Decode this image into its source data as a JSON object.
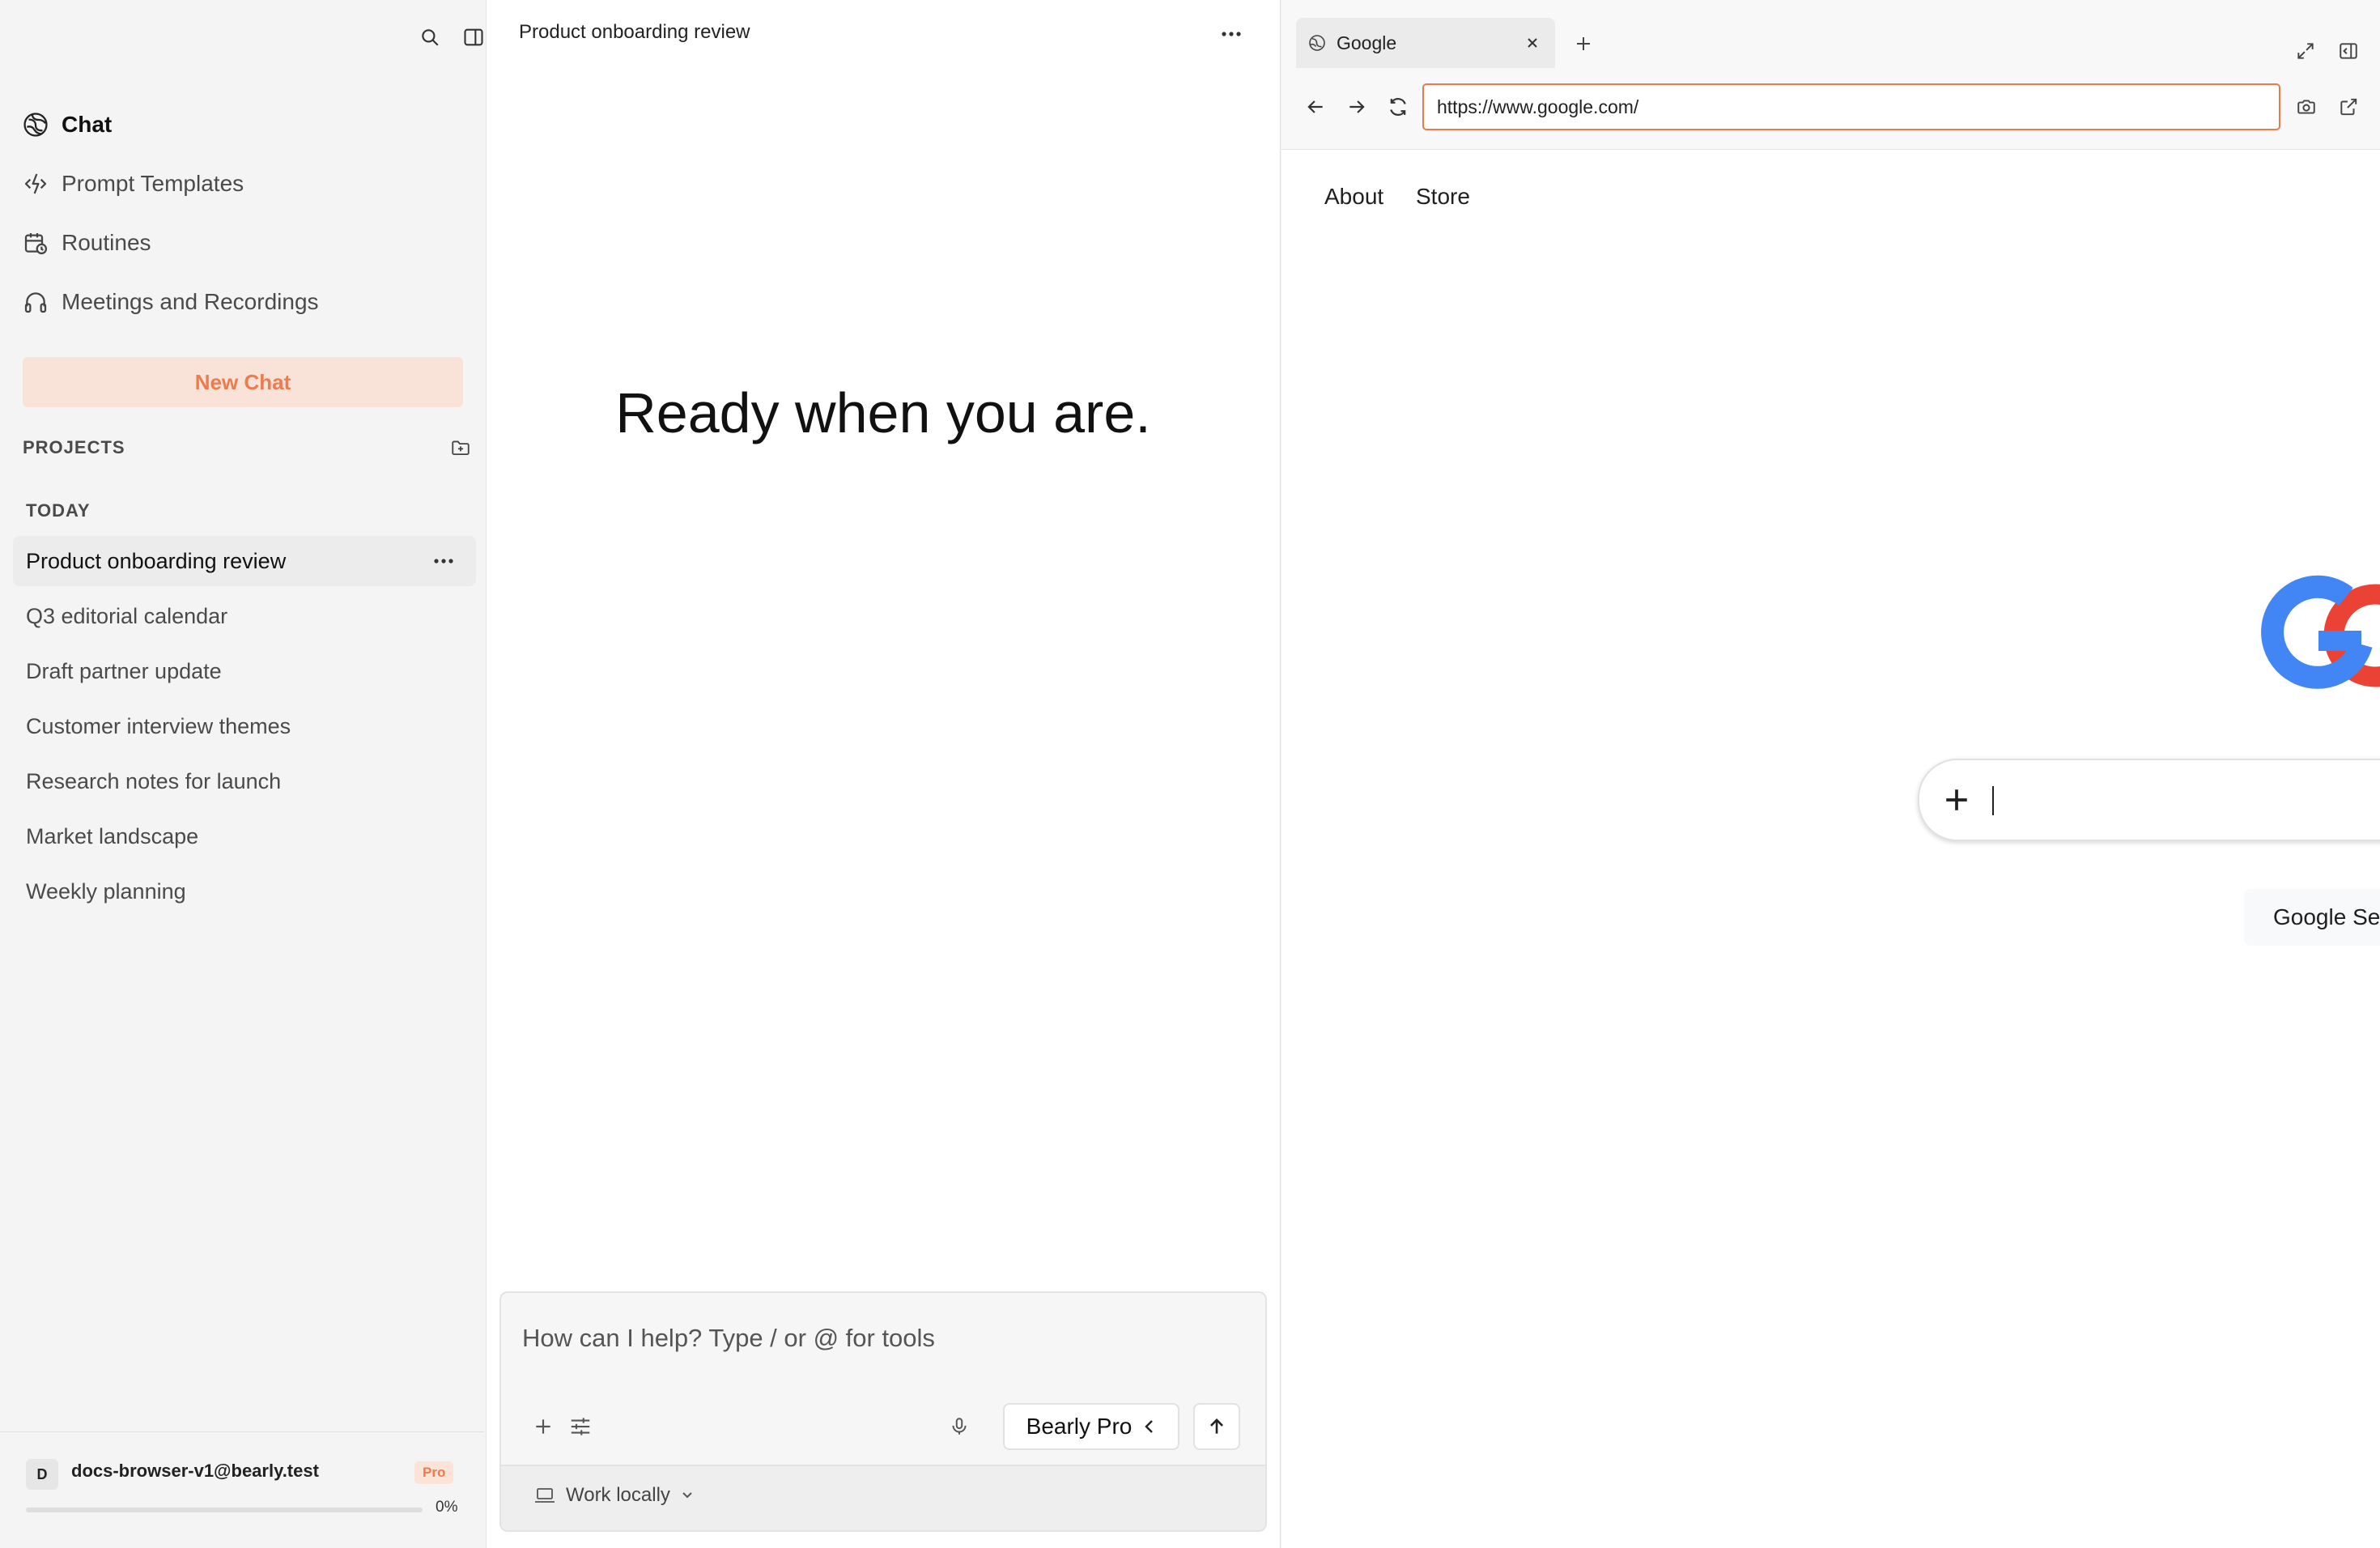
{
  "sidebar": {
    "nav": [
      {
        "label": "Chat",
        "icon": "chat-logo-icon"
      },
      {
        "label": "Prompt Templates",
        "icon": "prompt-templates-icon"
      },
      {
        "label": "Routines",
        "icon": "calendar-clock-icon"
      },
      {
        "label": "Meetings and Recordings",
        "icon": "headphones-icon"
      }
    ],
    "new_chat_label": "New Chat",
    "projects_label": "PROJECTS",
    "today_label": "TODAY",
    "conversations": [
      "Product onboarding review",
      "Q3 editorial calendar",
      "Draft partner update",
      "Customer interview themes",
      "Research notes for launch",
      "Market landscape",
      "Weekly planning"
    ],
    "user": {
      "initial": "D",
      "email": "docs-browser-v1@bearly.test",
      "plan": "Pro",
      "usage_label": "0%",
      "usage_fraction": 0
    }
  },
  "chat": {
    "title": "Product onboarding review",
    "hero": "Ready when you are.",
    "composer": {
      "placeholder": "How can I help? Type / or @ for tools",
      "model": "Bearly Pro",
      "mode": "Work locally"
    }
  },
  "browser": {
    "tab_title": "Google",
    "url": "https://www.google.com/",
    "page": {
      "links": [
        "About",
        "Store"
      ],
      "search_button": "Google Se"
    }
  },
  "colors": {
    "accent": "#ee7b4d",
    "google_blue": "#4285f4",
    "google_red": "#ea4335"
  }
}
